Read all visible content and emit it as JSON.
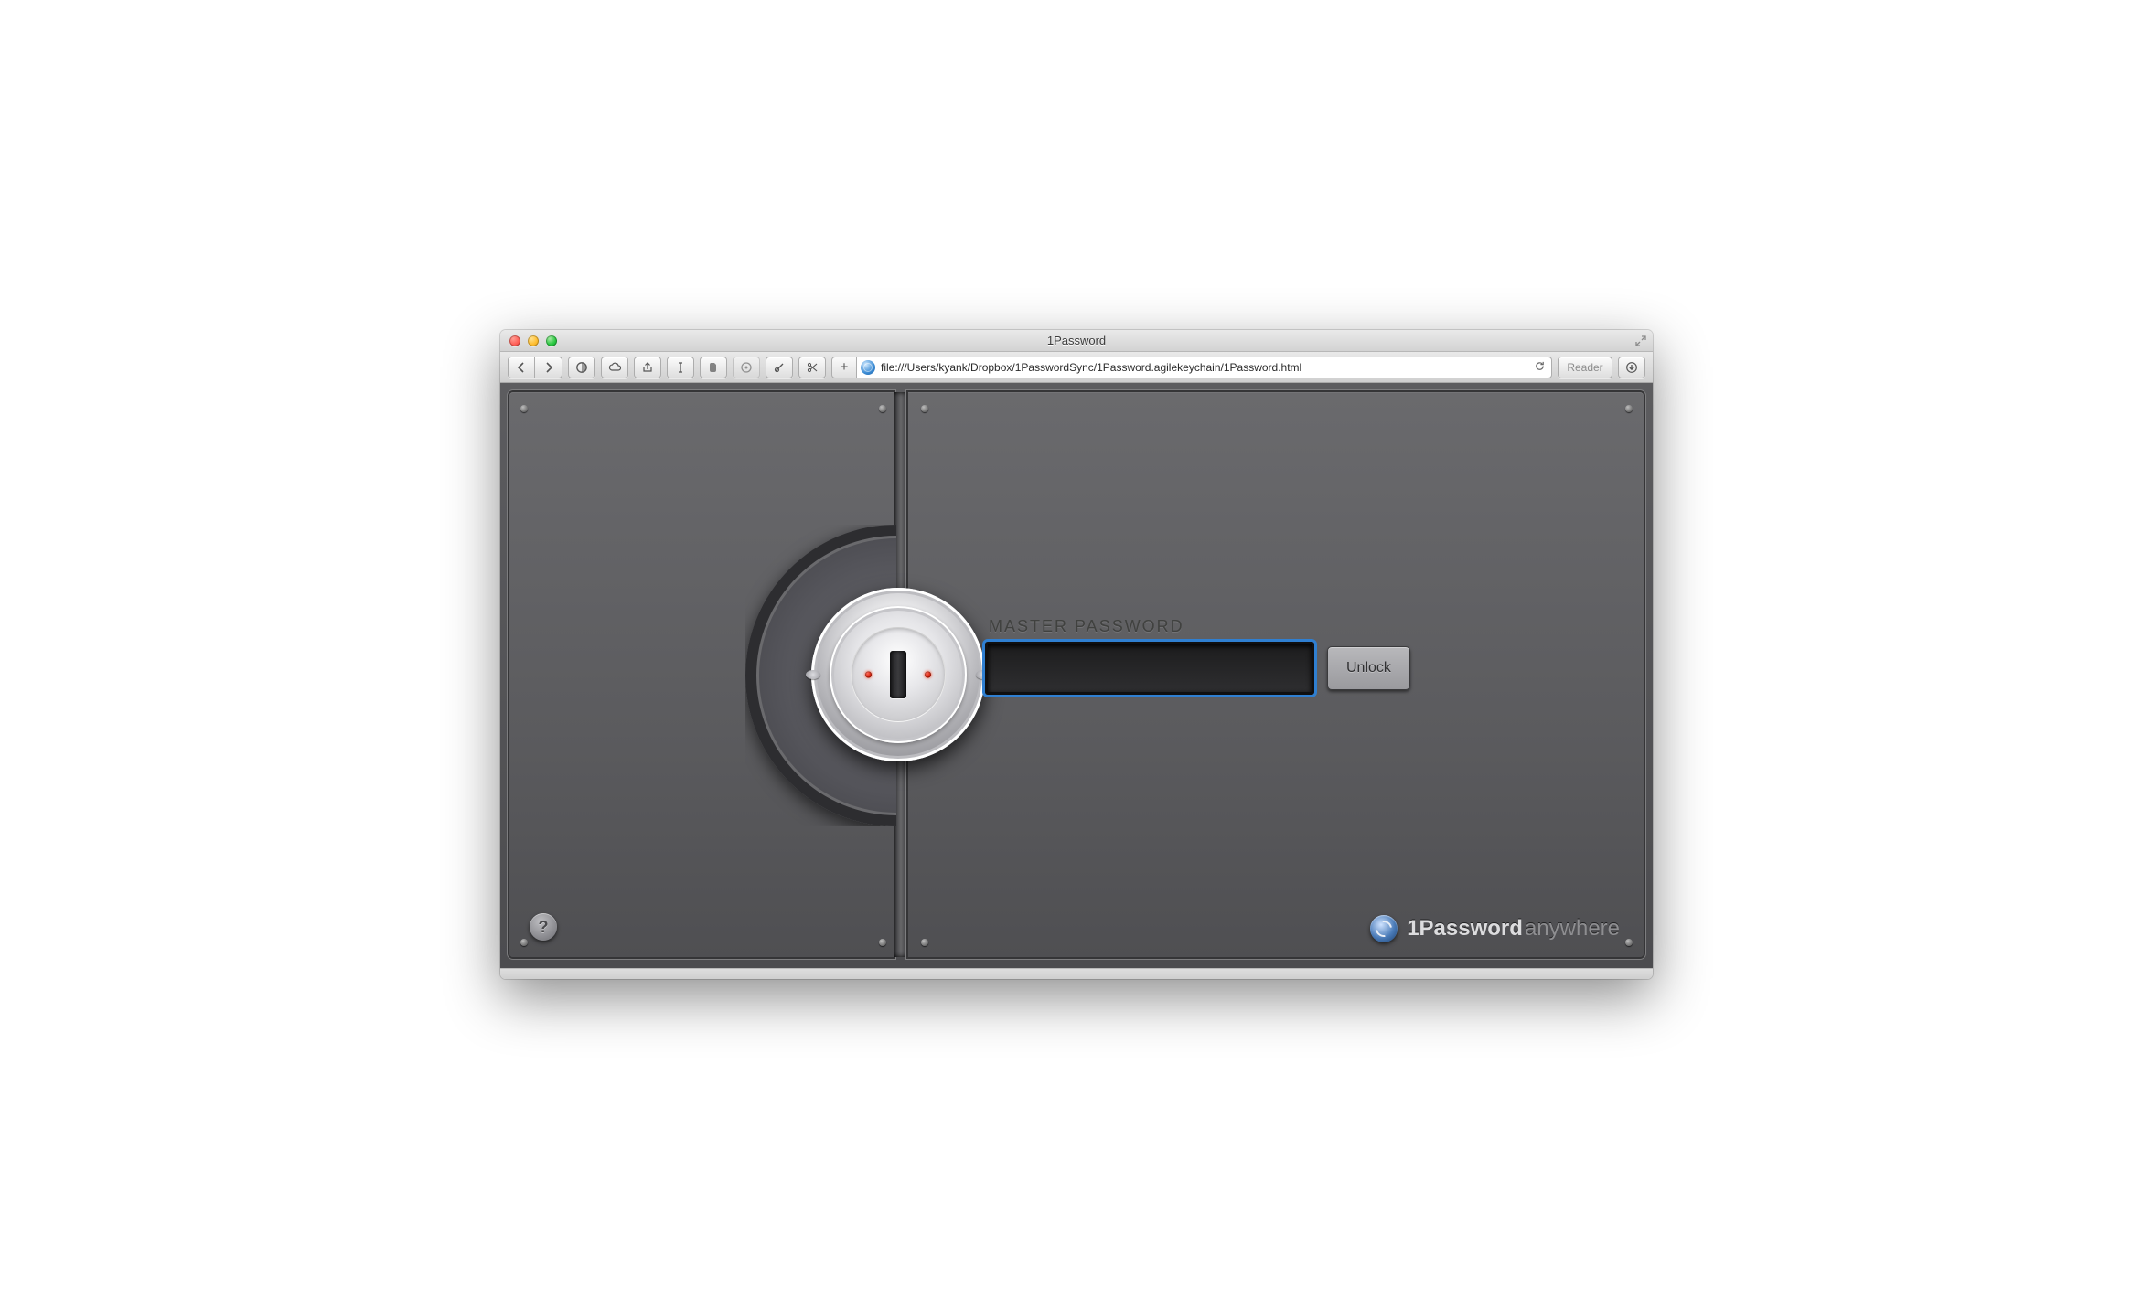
{
  "window": {
    "title": "1Password"
  },
  "toolbar": {
    "address": "file:///Users/kyank/Dropbox/1PasswordSync/1Password.agilekeychain/1Password.html",
    "reader_label": "Reader",
    "add_label": "+"
  },
  "vault": {
    "password_label": "MASTER PASSWORD",
    "password_value": "",
    "unlock_label": "Unlock",
    "help_label": "?",
    "brand_main": "1Password",
    "brand_sub": "anywhere"
  },
  "colors": {
    "focus_ring": "#2f7fd1"
  }
}
